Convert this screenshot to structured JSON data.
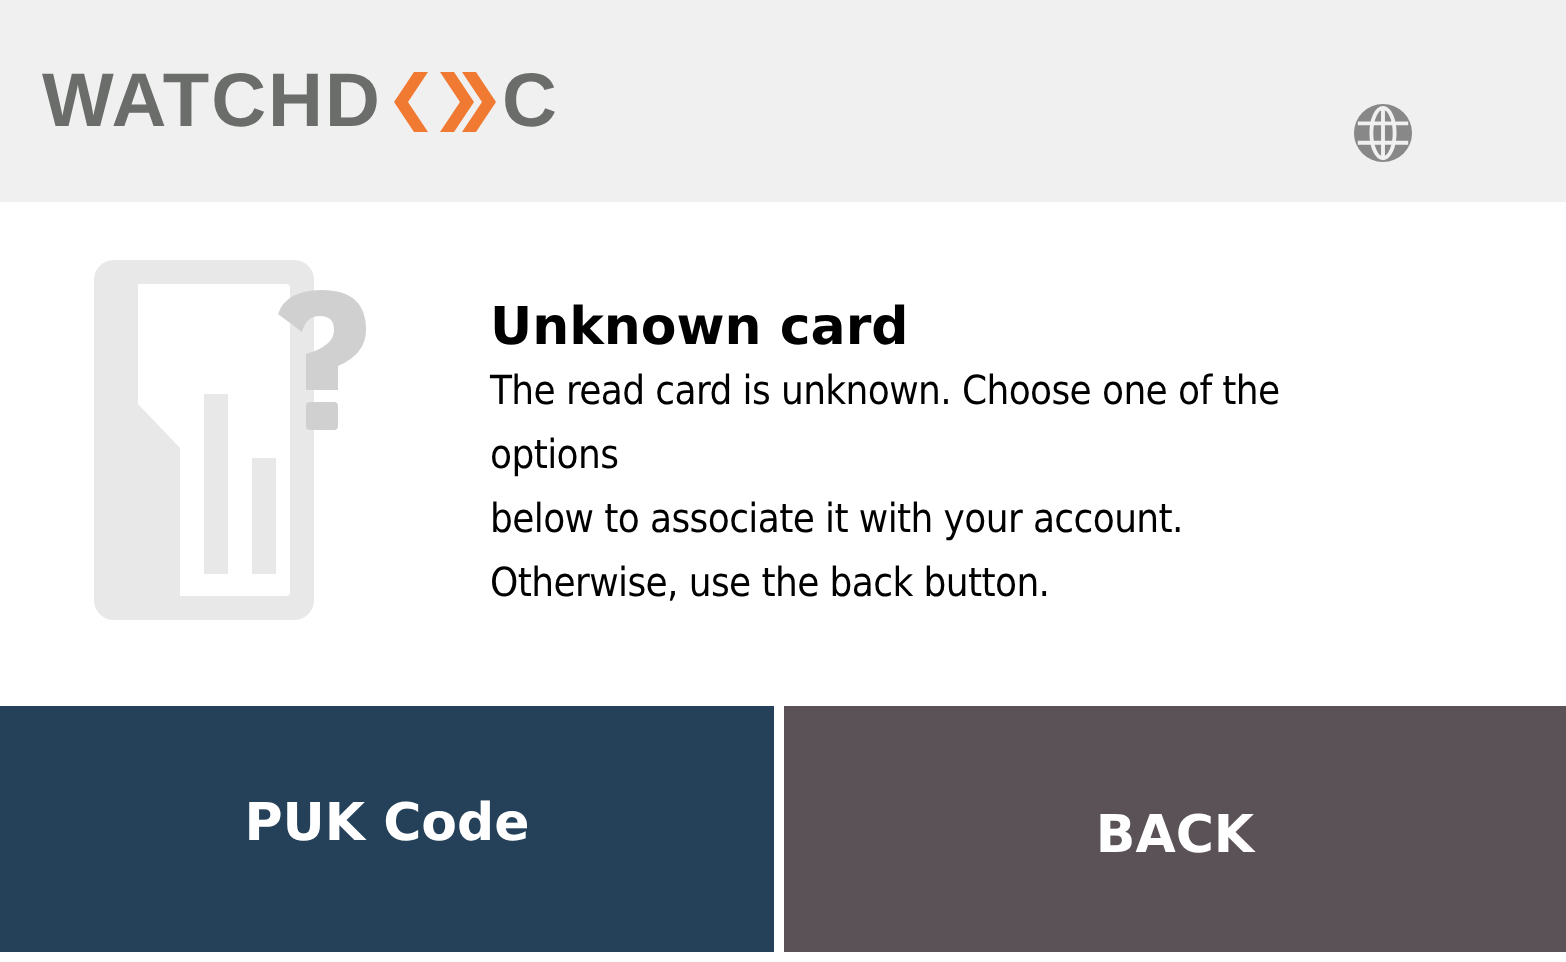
{
  "logo": {
    "left": "WATCHD",
    "right": "C"
  },
  "title": "Unknown card",
  "message_lines": [
    "The read card is unknown. Choose one of the",
    "options",
    "below to associate it with your account.",
    "Otherwise, use the back button."
  ],
  "buttons": [
    {
      "label": "PUK Code",
      "kind": "primary"
    },
    {
      "label": "BACK",
      "kind": "back"
    }
  ]
}
